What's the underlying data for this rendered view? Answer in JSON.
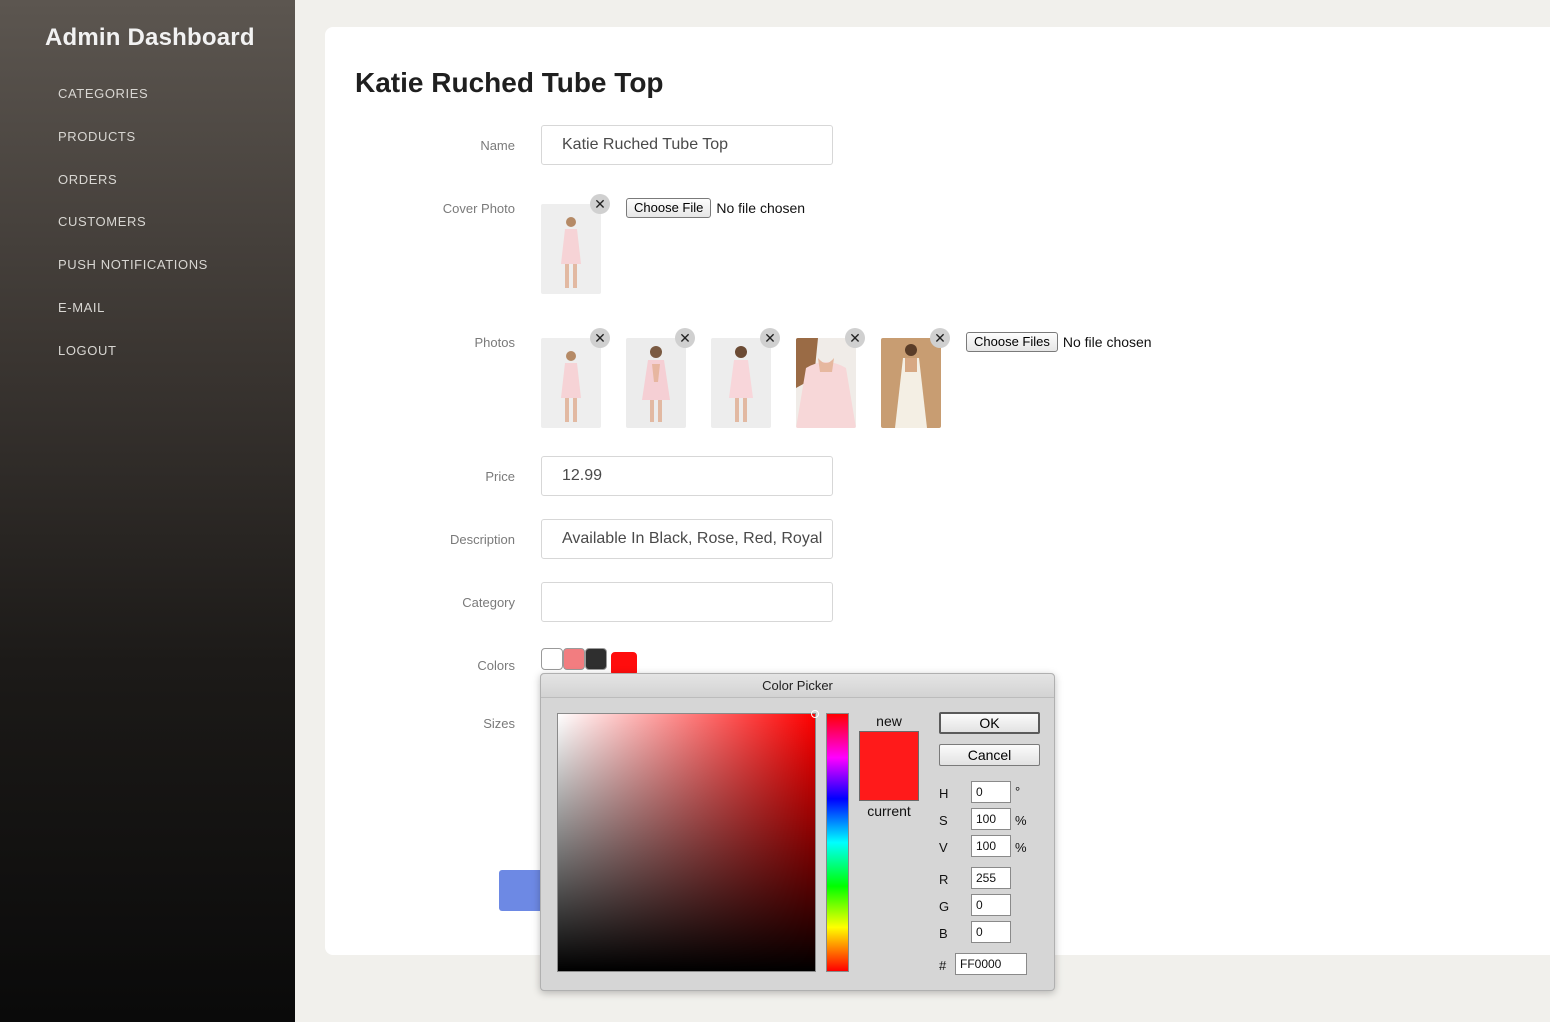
{
  "sidebar": {
    "title": "Admin Dashboard",
    "items": [
      {
        "label": "CATEGORIES"
      },
      {
        "label": "PRODUCTS"
      },
      {
        "label": "ORDERS"
      },
      {
        "label": "CUSTOMERS"
      },
      {
        "label": "PUSH NOTIFICATIONS"
      },
      {
        "label": "E-MAIL"
      },
      {
        "label": "LOGOUT"
      }
    ]
  },
  "form": {
    "title": "Katie Ruched Tube Top",
    "name_label": "Name",
    "name_value": "Katie Ruched Tube Top",
    "cover_label": "Cover Photo",
    "cover_button": "Choose File",
    "cover_status": "No file chosen",
    "photos_label": "Photos",
    "photos_button": "Choose Files",
    "photos_status": "No file chosen",
    "price_label": "Price",
    "price_value": "12.99",
    "description_label": "Description",
    "description_value": "Available In Black, Rose, Red, Royal",
    "category_label": "Category",
    "category_value": "",
    "colors_label": "Colors",
    "colors": [
      "#ffffff",
      "#f27d80",
      "#2f2f2f",
      "#ff0d0d"
    ],
    "sizes_label": "Sizes",
    "remove_glyph": "✕"
  },
  "picker": {
    "title": "Color Picker",
    "new_label": "new",
    "current_label": "current",
    "new_color": "#ff1a1a",
    "current_color": "#ff1a1a",
    "ok_label": "OK",
    "cancel_label": "Cancel",
    "h_label": "H",
    "h_value": "0",
    "h_unit": "°",
    "s_label": "S",
    "s_value": "100",
    "s_unit": "%",
    "v_label": "V",
    "v_value": "100",
    "v_unit": "%",
    "r_label": "R",
    "r_value": "255",
    "g_label": "G",
    "g_value": "0",
    "b_label": "B",
    "b_value": "0",
    "hex_label": "#",
    "hex_value": "FF0000"
  },
  "colors": {
    "accent_button": "#6d89e4"
  }
}
